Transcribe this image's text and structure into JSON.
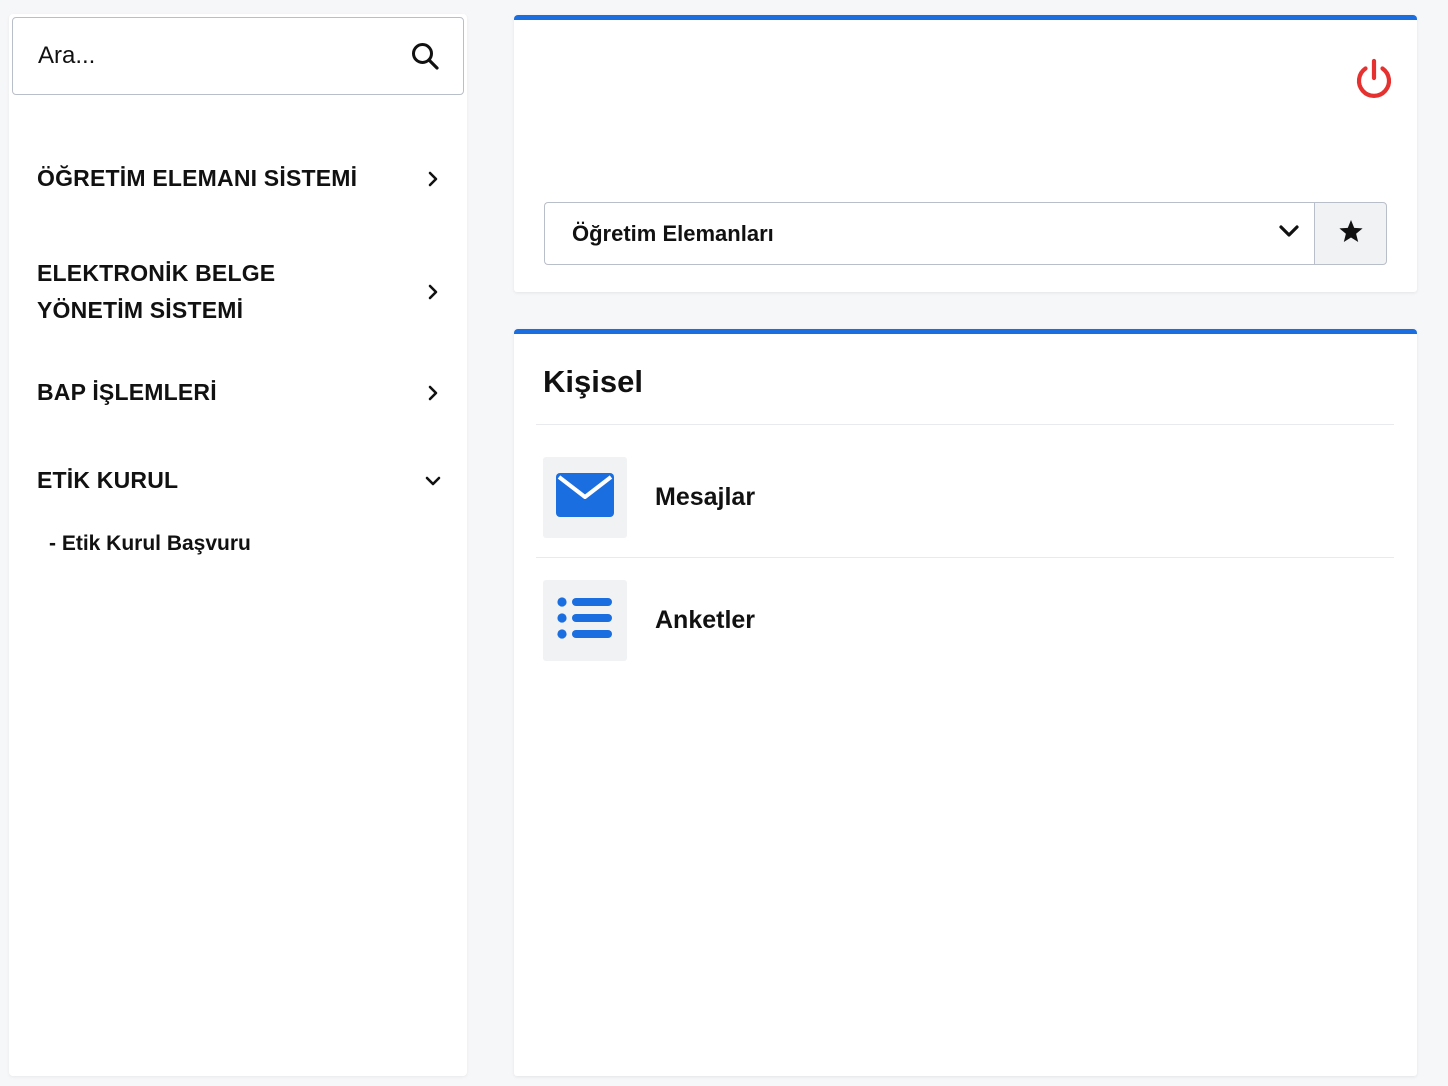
{
  "search": {
    "placeholder": "Ara..."
  },
  "sidebar": {
    "items": [
      {
        "label": "ÖĞRETİM ELEMANI SİSTEMİ",
        "expanded": false
      },
      {
        "label": "ELEKTRONİK BELGE YÖNETİM SİSTEMİ",
        "expanded": false
      },
      {
        "label": "BAP İŞLEMLERİ",
        "expanded": false
      },
      {
        "label": "ETİK KURUL",
        "expanded": true,
        "children": [
          {
            "label": "- Etik Kurul Başvuru"
          }
        ]
      }
    ]
  },
  "header": {
    "role_select": {
      "value": "Öğretim Elemanları"
    }
  },
  "personal": {
    "title": "Kişisel",
    "links": [
      {
        "label": "Mesajlar",
        "icon": "envelope-icon"
      },
      {
        "label": "Anketler",
        "icon": "list-icon"
      }
    ]
  },
  "colors": {
    "accent": "#1a6ee0",
    "power": "#e5312f",
    "tile_bg": "#f1f2f4"
  }
}
